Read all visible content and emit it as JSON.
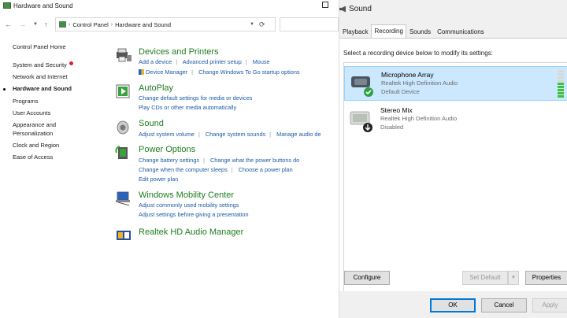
{
  "control_panel": {
    "window_title": "Hardware and Sound",
    "breadcrumb": [
      "Control Panel",
      "Hardware and Sound"
    ],
    "sidebar": [
      {
        "label": "Control Panel Home"
      },
      {
        "label": "System and Security"
      },
      {
        "label": "Network and Internet"
      },
      {
        "label": "Hardware and Sound",
        "active": true
      },
      {
        "label": "Programs"
      },
      {
        "label": "User Accounts"
      },
      {
        "label": "Appearance and"
      },
      {
        "label": "Personalization"
      },
      {
        "label": "Clock and Region"
      },
      {
        "label": "Ease of Access"
      }
    ],
    "categories": [
      {
        "title": "Devices and Printers",
        "icon": "printer-icon",
        "links": [
          [
            "Add a device",
            "Advanced printer setup",
            "Mouse"
          ],
          [
            "Device Manager",
            "Change Windows To Go startup options"
          ]
        ]
      },
      {
        "title": "AutoPlay",
        "icon": "autoplay-icon",
        "links": [
          [
            "Change default settings for media or devices"
          ],
          [
            "Play CDs or other media automatically"
          ]
        ]
      },
      {
        "title": "Sound",
        "icon": "speaker-icon",
        "links": [
          [
            "Adjust system volume",
            "Change system sounds",
            "Manage audio de"
          ]
        ]
      },
      {
        "title": "Power Options",
        "icon": "power-options-icon",
        "links": [
          [
            "Change battery settings",
            "Change what the power buttons do"
          ],
          [
            "Change when the computer sleeps",
            "Choose a power plan"
          ],
          [
            "Edit power plan"
          ]
        ]
      },
      {
        "title": "Windows Mobility Center",
        "icon": "mobility-center-icon",
        "links": [
          [
            "Adjust commonly used mobility settings"
          ],
          [
            "Adjust settings before giving a presentation"
          ]
        ]
      },
      {
        "title": "Realtek HD Audio Manager",
        "icon": "realtek-icon",
        "links": []
      }
    ]
  },
  "sound_dialog": {
    "title": "Sound",
    "tabs": [
      {
        "label": "Playback"
      },
      {
        "label": "Recording",
        "active": true
      },
      {
        "label": "Sounds"
      },
      {
        "label": "Communications"
      }
    ],
    "instruction": "Select a recording device below to modify its settings:",
    "devices": [
      {
        "name": "Microphone Array",
        "driver": "Realtek High Definition Audio",
        "status": "Default Device",
        "selected": true,
        "level": 0.6
      },
      {
        "name": "Stereo Mix",
        "driver": "Realtek High Definition Audio",
        "status": "Disabled",
        "selected": false
      }
    ],
    "buttons": {
      "configure": "Configure",
      "set_default": "Set Default",
      "properties": "Properties",
      "ok": "OK",
      "cancel": "Cancel",
      "apply": "Apply"
    },
    "colors": {
      "selection": "#cce8ff",
      "level_on": "#3cc23c",
      "link": "#1a5aa8",
      "category_title": "#1e7d1e"
    }
  }
}
